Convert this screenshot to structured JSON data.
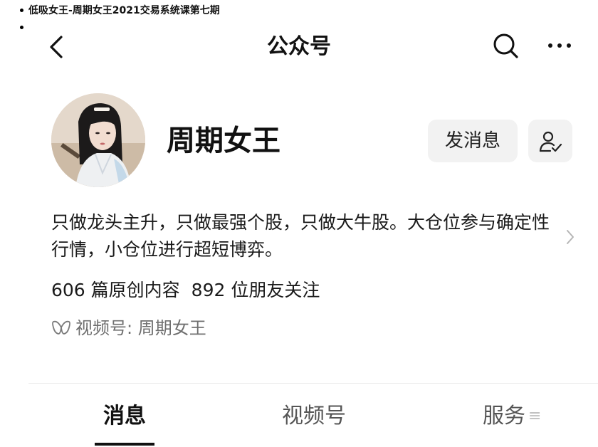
{
  "bullets": [
    {
      "text": "低吸女王-周期女王2021交易系统课第七期"
    },
    {
      "text": ""
    }
  ],
  "nav": {
    "title": "公众号",
    "back_icon": "chevron-left-icon",
    "search_icon": "search-icon",
    "more_icon": "more-horizontal-icon"
  },
  "profile": {
    "name": "周期女王",
    "message_button": "发消息",
    "follow_icon": "user-check-icon",
    "description": "只做龙头主升，只做最强个股，只做大牛股。大仓位参与确定性行情，小仓位进行超短博弈。",
    "stats": {
      "articles": "606 篇原创内容",
      "followers": "892 位朋友关注"
    },
    "channel_label": "视频号: 周期女王"
  },
  "tabs": [
    {
      "label": "消息"
    },
    {
      "label": "视频号"
    },
    {
      "label": "服务",
      "suffix_glyph": "≡"
    }
  ],
  "colors": {
    "text_primary": "#111111",
    "text_secondary": "#6f6f6f",
    "button_bg": "#f2f2f2",
    "divider": "#ececec"
  }
}
